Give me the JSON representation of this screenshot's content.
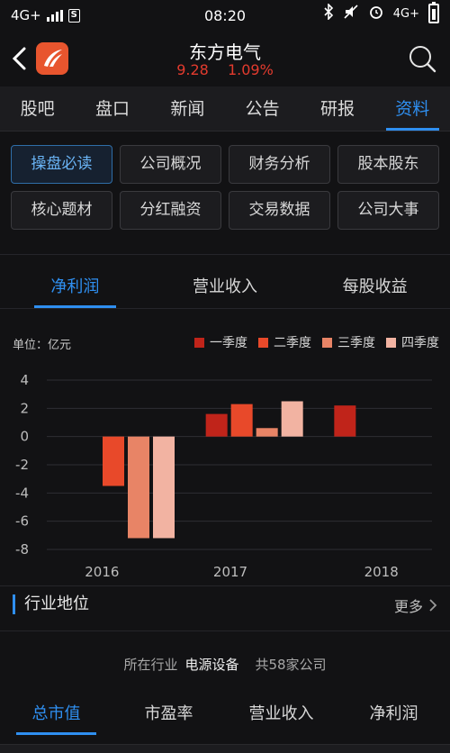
{
  "status": {
    "left_network": "4G+",
    "time": "08:20",
    "right_network": "4G+"
  },
  "header": {
    "name": "东方电气",
    "price": "9.28",
    "change_pct": "1.09%"
  },
  "tabs": [
    "股吧",
    "盘口",
    "新闻",
    "公告",
    "研报",
    "资料"
  ],
  "active_tab": 5,
  "grid_buttons": [
    "操盘必读",
    "公司概况",
    "财务分析",
    "股本股东",
    "核心题材",
    "分红融资",
    "交易数据",
    "公司大事"
  ],
  "active_grid": 0,
  "chart_tabs": [
    "净利润",
    "营业收入",
    "每股收益"
  ],
  "active_chart_tab": 0,
  "unit_label": "单位：亿元",
  "colors": {
    "accent": "#2f8ff0",
    "up": "#e33b2e",
    "q1": "#c0241a",
    "q2": "#e8492a",
    "q3": "#e88466",
    "q4": "#f2b3a2"
  },
  "chart_data": {
    "type": "bar",
    "categories": [
      "2016",
      "2017",
      "2018"
    ],
    "series": [
      {
        "name": "一季度",
        "values": [
          null,
          1.6,
          2.2
        ]
      },
      {
        "name": "二季度",
        "values": [
          -3.5,
          2.3,
          null
        ]
      },
      {
        "name": "三季度",
        "values": [
          -7.2,
          0.6,
          null
        ]
      },
      {
        "name": "四季度",
        "values": [
          -7.2,
          2.5,
          null
        ]
      }
    ],
    "yticks": [
      4,
      2,
      0,
      -2,
      -4,
      -6,
      -8
    ],
    "ylim": [
      -8,
      4
    ],
    "grid": true,
    "legend": "top-right"
  },
  "industry": {
    "title": "行业地位",
    "more": "更多",
    "label_industry": "所在行业",
    "industry_name": "电源设备",
    "count_text": "共58家公司"
  },
  "bottom_tabs": [
    "总市值",
    "市盈率",
    "营业收入",
    "净利润"
  ],
  "active_bottom_tab": 0
}
